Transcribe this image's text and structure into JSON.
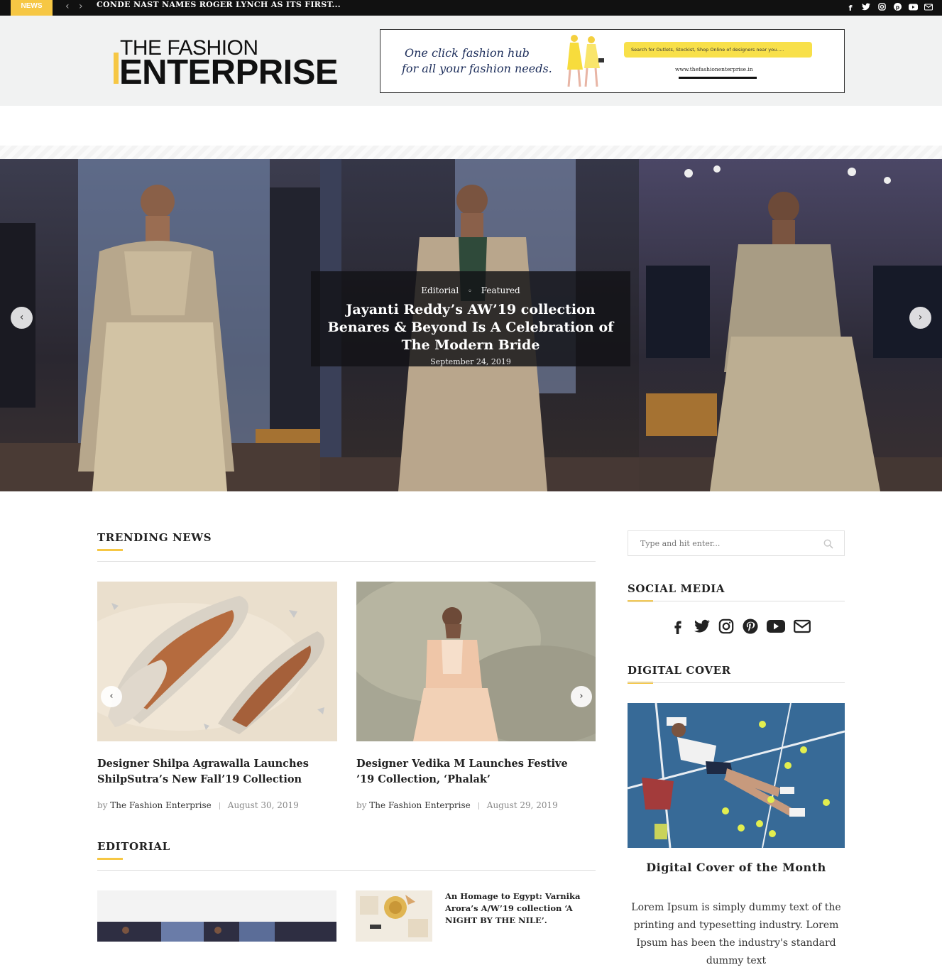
{
  "topbar": {
    "badge": "NEWS",
    "prev": "‹",
    "next": "›",
    "ticker": "CONDE NAST NAMES ROGER LYNCH AS ITS FIRST...",
    "social_icons": [
      "facebook-icon",
      "twitter-icon",
      "instagram-icon",
      "pinterest-icon",
      "youtube-icon",
      "mail-icon"
    ]
  },
  "header": {
    "logo_top": "THE FASHION",
    "logo_bottom": "ENTERPRISE",
    "banner": {
      "tagline_1": "One click fashion hub",
      "tagline_2": "for all your fashion needs.",
      "search_text": "Search for Outlets, Stockist, Shop Online of designers near you.....",
      "url": "www.thefashionenterprise.in"
    }
  },
  "slider": {
    "categories": [
      "Editorial",
      "Featured"
    ],
    "cat_separator": "◦",
    "title": "Jayanti Reddy’s AW’19 collection Benares & Beyond Is A Celebration of The Modern Bride",
    "date": "September 24, 2019",
    "prev": "‹",
    "next": "›"
  },
  "trending": {
    "title": "TRENDING NEWS",
    "prev": "‹",
    "next": "›",
    "posts": [
      {
        "title": "Designer Shilpa Agrawalla Launches ShilpSutra’s New Fall’19 Collection",
        "by": "by",
        "author": "The Fashion Enterprise",
        "date": "August 30, 2019"
      },
      {
        "title": "Designer Vedika M Launches Festive ’19 Collection, ‘Phalak’",
        "by": "by",
        "author": "The Fashion Enterprise",
        "date": "August 29, 2019"
      }
    ]
  },
  "editorial": {
    "title": "EDITORIAL",
    "side_post": "An Homage to Egypt: Varnika Arora’s A/W’19 collection ‘A NIGHT BY THE NILE’."
  },
  "sidebar": {
    "search_placeholder": "Type and hit enter...",
    "social_title": "SOCIAL MEDIA",
    "social_icons": [
      "facebook-icon",
      "twitter-icon",
      "instagram-icon",
      "pinterest-icon",
      "youtube-icon",
      "mail-icon"
    ],
    "cover_section": "DIGITAL COVER",
    "cover_title": "Digital Cover of the Month",
    "cover_text": "Lorem Ipsum is simply dummy text of the printing and typesetting industry. Lorem Ipsum has been the industry's standard dummy text"
  },
  "colors": {
    "accent": "#f6c744",
    "dark": "#111111",
    "header_bg": "#f1f2f2"
  }
}
